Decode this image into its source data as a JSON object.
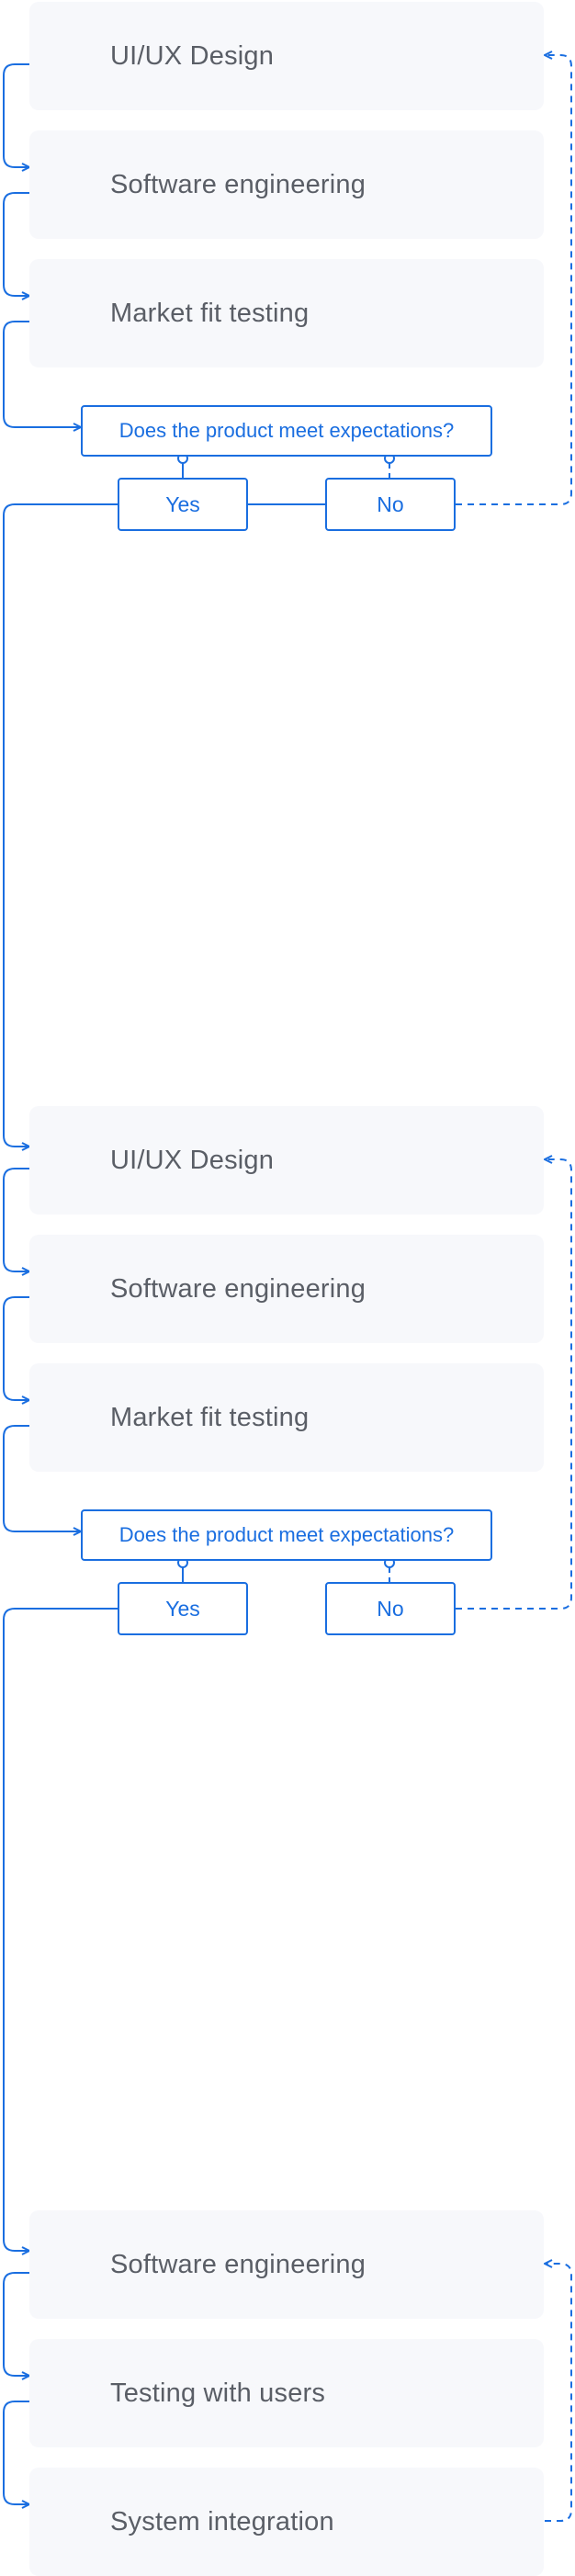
{
  "colors": {
    "accent": "#1a6ee0",
    "card_bg": "#f7f8fb",
    "card_text": "#5a5e66"
  },
  "flow_1": {
    "steps": [
      "UI/UX Design",
      "Software engineering",
      "Market fit testing"
    ],
    "question": "Does the product meet expectations?",
    "yes": "Yes",
    "no": "No"
  },
  "flow_2": {
    "steps": [
      "UI/UX Design",
      "Software engineering",
      "Market fit testing"
    ],
    "question": "Does the product meet expectations?",
    "yes": "Yes",
    "no": "No"
  },
  "flow_3": {
    "steps": [
      "Software engineering",
      "Testing with users",
      "System integration"
    ]
  }
}
